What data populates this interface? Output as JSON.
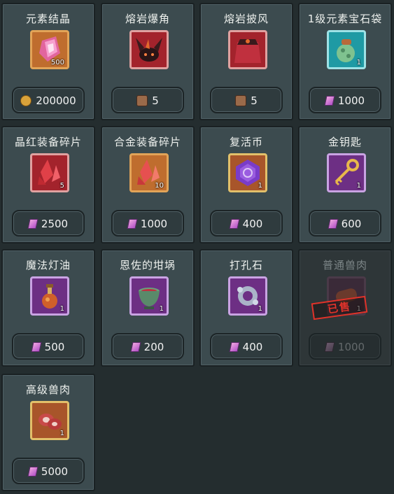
{
  "items": [
    {
      "name": "元素结晶",
      "qty": "500",
      "price": "200000",
      "currency": "coin-icon",
      "icon": "element-crystal-icon",
      "frame": "orange"
    },
    {
      "name": "熔岩爆角",
      "qty": "",
      "price": "5",
      "currency": "lava-token-icon",
      "icon": "lava-horn-icon",
      "frame": "red"
    },
    {
      "name": "熔岩披风",
      "qty": "",
      "price": "5",
      "currency": "lava-token-icon",
      "icon": "lava-cape-icon",
      "frame": "red"
    },
    {
      "name": "1级元素宝石袋",
      "qty": "1",
      "price": "1000",
      "currency": "gem-icon",
      "icon": "gem-bag-icon",
      "frame": "cyan"
    },
    {
      "name": "晶红装备碎片",
      "qty": "5",
      "price": "2500",
      "currency": "gem-icon",
      "icon": "red-shard-icon",
      "frame": "red"
    },
    {
      "name": "合金装备碎片",
      "qty": "10",
      "price": "1000",
      "currency": "gem-icon",
      "icon": "alloy-shard-icon",
      "frame": "orange"
    },
    {
      "name": "复活币",
      "qty": "1",
      "price": "400",
      "currency": "gem-icon",
      "icon": "revive-coin-icon",
      "frame": "amber"
    },
    {
      "name": "金钥匙",
      "qty": "1",
      "price": "600",
      "currency": "gem-icon",
      "icon": "gold-key-icon",
      "frame": "purple"
    },
    {
      "name": "魔法灯油",
      "qty": "1",
      "price": "500",
      "currency": "gem-icon",
      "icon": "lamp-oil-icon",
      "frame": "purple"
    },
    {
      "name": "恩佐的坩埚",
      "qty": "1",
      "price": "200",
      "currency": "gem-icon",
      "icon": "crucible-icon",
      "frame": "purple"
    },
    {
      "name": "打孔石",
      "qty": "1",
      "price": "400",
      "currency": "gem-icon",
      "icon": "punch-stone-icon",
      "frame": "purple"
    },
    {
      "name": "普通兽肉",
      "qty": "1",
      "price": "1000",
      "currency": "gem-icon",
      "icon": "meat-icon",
      "frame": "sold",
      "sold": true,
      "sold_label": "已售"
    },
    {
      "name": "高级兽肉",
      "qty": "1",
      "price": "5000",
      "currency": "gem-icon",
      "icon": "premium-meat-icon",
      "frame": "amber"
    }
  ]
}
